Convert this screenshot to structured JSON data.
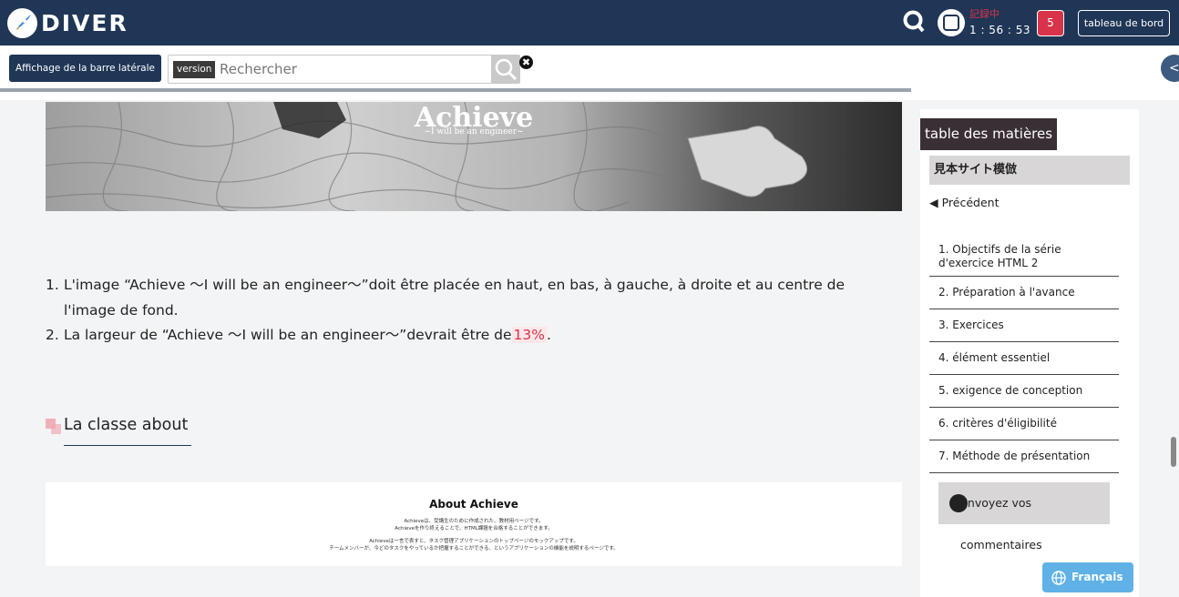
{
  "header": {
    "logo_text": "DIVER",
    "q_label": "Q",
    "rec_label": "記録中",
    "timer": "1 : 56 : 53",
    "notification_count": "5",
    "dashboard_label": "tableau de bord"
  },
  "toolbar": {
    "sidebar_toggle_label": "Affichage de la barre latérale",
    "version_label": "version",
    "search_placeholder": "Rechercher",
    "clear_label": "✖",
    "collapse_label": "<"
  },
  "hero": {
    "title": "Achieve",
    "subtitle": "~I will be an engineer~"
  },
  "steps": [
    {
      "num": "1.",
      "text": "L'image “Achieve 〜I will be an engineer〜”doit être placée en haut, en bas, à gauche, à droite et au centre de l'image de fond."
    },
    {
      "num": "2.",
      "text_before": "La largeur de “Achieve 〜I will be an engineer〜”devrait être de",
      "highlight": "13%",
      "text_after": "."
    }
  ],
  "section": {
    "title": "La classe about"
  },
  "preview": {
    "title": "About Achieve",
    "lines": [
      "Achieveは、受講生のために作成された、教材用ページです。",
      "Achieveを作り終えることで、HTML課題を合格することができます。",
      "Achieveは一言で表すと、タスク管理アプリケーションのトップページのモックアップです。",
      "チームメンバーが、今どのタスクをやっているか把握することができる、というアプリケーションの機能を説明するページです。"
    ]
  },
  "toc": {
    "header": "table des matières",
    "site_title": "見本サイト模倣",
    "prev_label": "◀  Précédent",
    "items": [
      "1. Objectifs de la série d'exercice HTML 2",
      "2. Préparation à l'avance",
      "3. Exercices",
      "4. élément essentiel",
      "5. exigence de conception",
      "6. critères d'éligibilité",
      "7. Méthode de présentation"
    ],
    "feedback_label": "Envoyez vos commentaires"
  },
  "language": {
    "label": "Français"
  },
  "colors": {
    "header_bg": "#1f3656",
    "accent_red": "#d8334a",
    "toc_header_bg": "#3a2f35",
    "lang_btn": "#5fb1e6"
  }
}
